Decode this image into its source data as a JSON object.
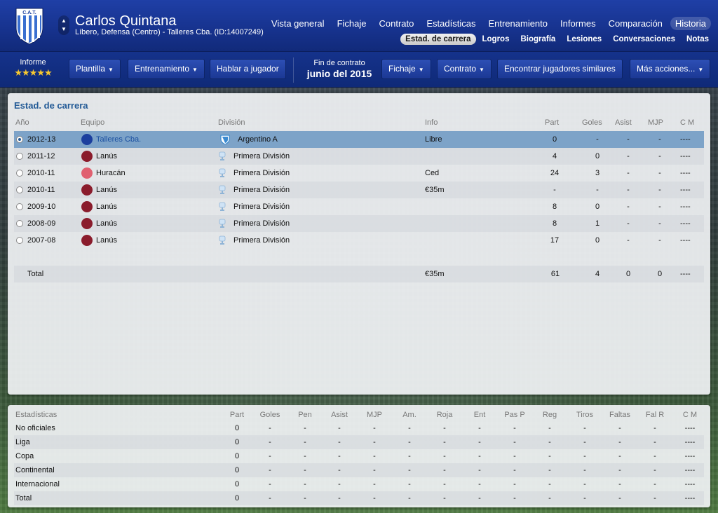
{
  "header": {
    "crest_text": "C.A.T.",
    "player_name": "Carlos Quintana",
    "player_subtitle": "Líbero, Defensa (Centro) - Talleres Cba. (ID:14007249)",
    "nav": [
      "Vista general",
      "Fichaje",
      "Contrato",
      "Estadísticas",
      "Entrenamiento",
      "Informes",
      "Comparación",
      "Historia"
    ],
    "nav_active": "Historia",
    "subnav": [
      "Estad. de carrera",
      "Logros",
      "Biografía",
      "Lesiones",
      "Conversaciones",
      "Notas"
    ],
    "subnav_active": "Estad. de carrera"
  },
  "toolbar": {
    "report_label": "Informe",
    "rating_stars": 4.5,
    "stars_text": "★★★★★",
    "plantilla": "Plantilla",
    "entrenamiento": "Entrenamiento",
    "hablar": "Hablar a jugador",
    "contract_label": "Fin de contrato",
    "contract_date": "junio del 2015",
    "fichaje": "Fichaje",
    "contrato": "Contrato",
    "similares": "Encontrar jugadores similares",
    "mas_acciones": "Más acciones..."
  },
  "career": {
    "title": "Estad. de carrera",
    "columns": {
      "year": "Año",
      "team": "Equipo",
      "division": "División",
      "info": "Info",
      "part": "Part",
      "goles": "Goles",
      "asist": "Asist",
      "mjp": "MJP",
      "cm": "C M"
    },
    "rows": [
      {
        "year": "2012-13",
        "team": "Talleres Cba.",
        "division": "Argentino A",
        "info": "Libre",
        "part": "0",
        "goles": "-",
        "asist": "-",
        "mjp": "-",
        "cm": "----",
        "club_color": "#1c3f9e",
        "selected": true
      },
      {
        "year": "2011-12",
        "team": "Lanús",
        "division": "Primera División",
        "info": "",
        "part": "4",
        "goles": "0",
        "asist": "-",
        "mjp": "-",
        "cm": "----",
        "club_color": "#8a1c2c",
        "selected": false
      },
      {
        "year": "2010-11",
        "team": "Huracán",
        "division": "Primera División",
        "info": "Ced",
        "part": "24",
        "goles": "3",
        "asist": "-",
        "mjp": "-",
        "cm": "----",
        "club_color": "#e06070",
        "selected": false
      },
      {
        "year": "2010-11",
        "team": "Lanús",
        "division": "Primera División",
        "info": "€35m",
        "part": "-",
        "goles": "-",
        "asist": "-",
        "mjp": "-",
        "cm": "----",
        "club_color": "#8a1c2c",
        "selected": false
      },
      {
        "year": "2009-10",
        "team": "Lanús",
        "division": "Primera División",
        "info": "",
        "part": "8",
        "goles": "0",
        "asist": "-",
        "mjp": "-",
        "cm": "----",
        "club_color": "#8a1c2c",
        "selected": false
      },
      {
        "year": "2008-09",
        "team": "Lanús",
        "division": "Primera División",
        "info": "",
        "part": "8",
        "goles": "1",
        "asist": "-",
        "mjp": "-",
        "cm": "----",
        "club_color": "#8a1c2c",
        "selected": false
      },
      {
        "year": "2007-08",
        "team": "Lanús",
        "division": "Primera División",
        "info": "",
        "part": "17",
        "goles": "0",
        "asist": "-",
        "mjp": "-",
        "cm": "----",
        "club_color": "#8a1c2c",
        "selected": false
      }
    ],
    "total": {
      "label": "Total",
      "info": "€35m",
      "part": "61",
      "goles": "4",
      "asist": "0",
      "mjp": "0",
      "cm": "----"
    }
  },
  "stats": {
    "columns": [
      "Estadísticas",
      "Part",
      "Goles",
      "Pen",
      "Asist",
      "MJP",
      "Am.",
      "Roja",
      "Ent",
      "Pas P",
      "Reg",
      "Tiros",
      "Faltas",
      "Fal R",
      "C M"
    ],
    "rows": [
      {
        "label": "No oficiales",
        "values": [
          "0",
          "-",
          "-",
          "-",
          "-",
          "-",
          "-",
          "-",
          "-",
          "-",
          "-",
          "-",
          "-",
          "----"
        ]
      },
      {
        "label": "Liga",
        "values": [
          "0",
          "-",
          "-",
          "-",
          "-",
          "-",
          "-",
          "-",
          "-",
          "-",
          "-",
          "-",
          "-",
          "----"
        ]
      },
      {
        "label": "Copa",
        "values": [
          "0",
          "-",
          "-",
          "-",
          "-",
          "-",
          "-",
          "-",
          "-",
          "-",
          "-",
          "-",
          "-",
          "----"
        ]
      },
      {
        "label": "Continental",
        "values": [
          "0",
          "-",
          "-",
          "-",
          "-",
          "-",
          "-",
          "-",
          "-",
          "-",
          "-",
          "-",
          "-",
          "----"
        ]
      },
      {
        "label": "Internacional",
        "values": [
          "0",
          "-",
          "-",
          "-",
          "-",
          "-",
          "-",
          "-",
          "-",
          "-",
          "-",
          "-",
          "-",
          "----"
        ]
      },
      {
        "label": "Total",
        "values": [
          "0",
          "-",
          "-",
          "-",
          "-",
          "-",
          "-",
          "-",
          "-",
          "-",
          "-",
          "-",
          "-",
          "----"
        ]
      }
    ]
  }
}
